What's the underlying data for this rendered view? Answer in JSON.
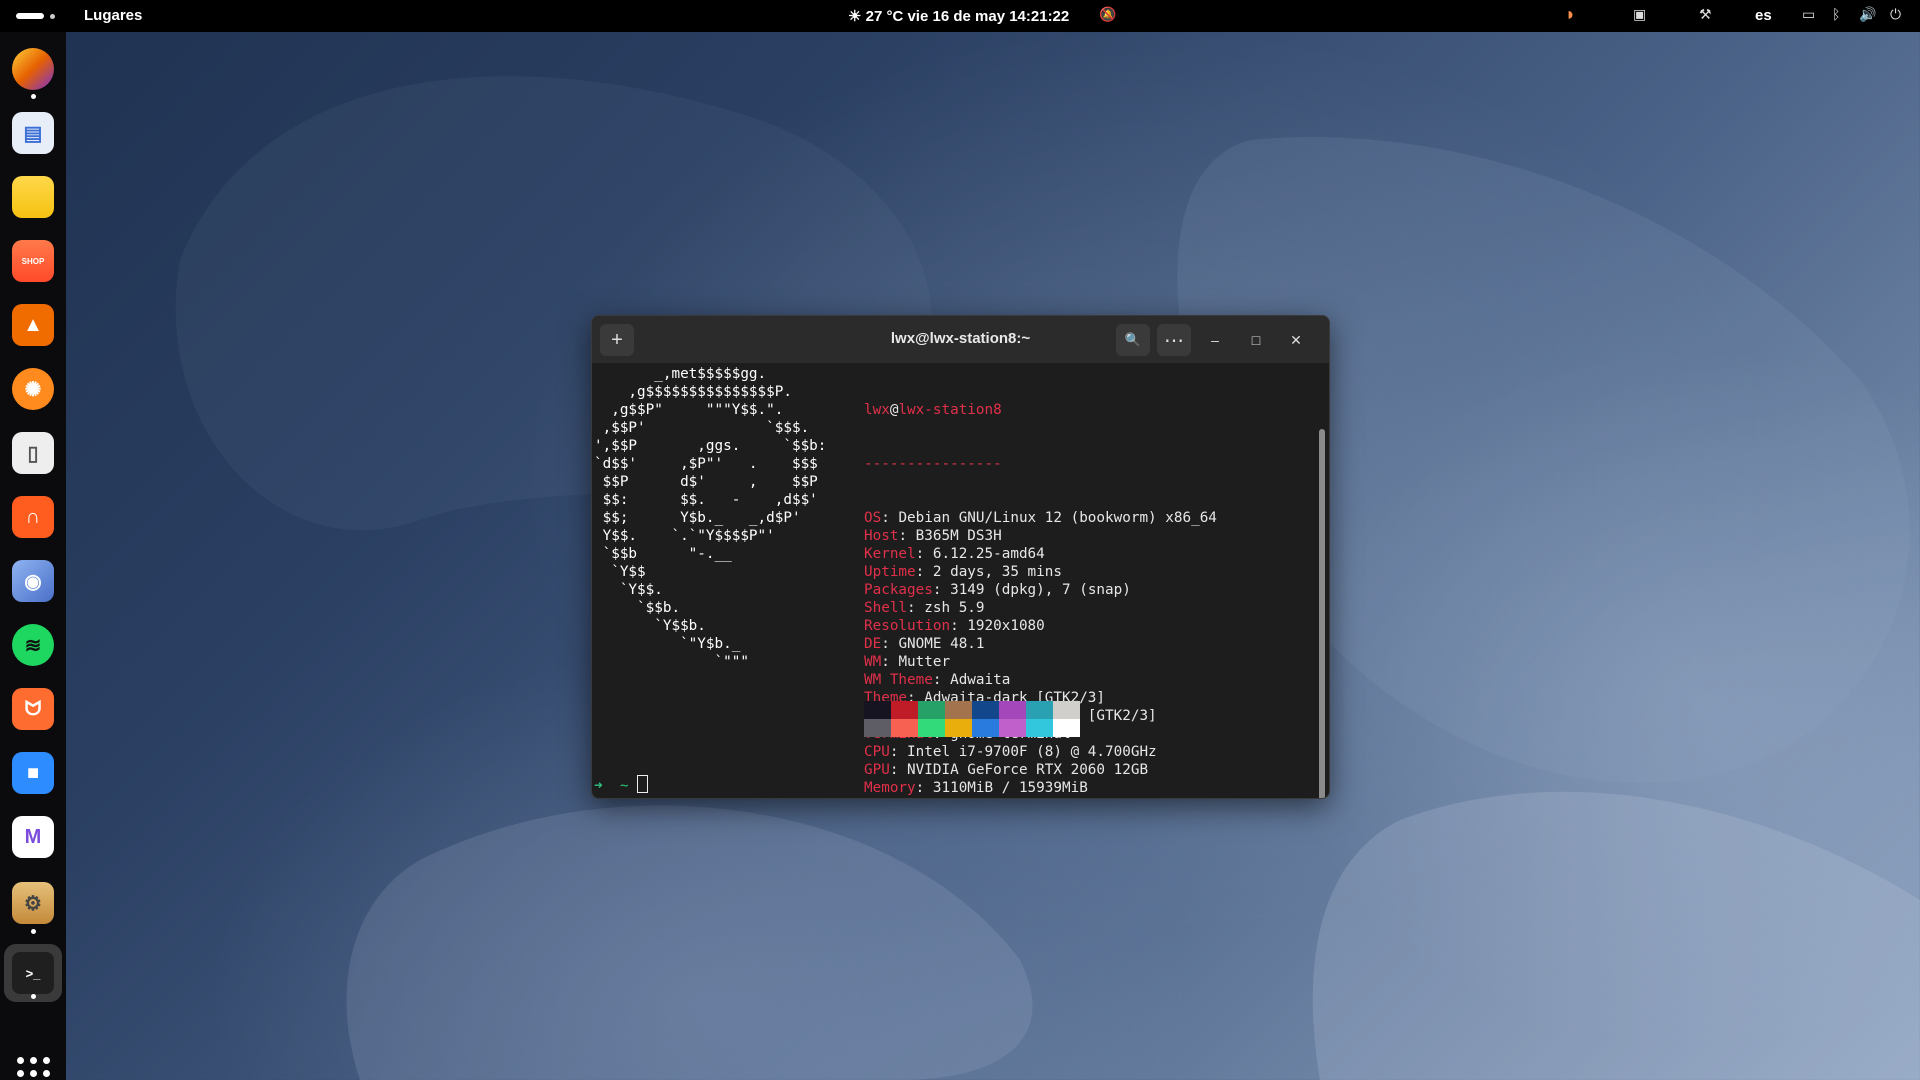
{
  "topbar": {
    "activities": "",
    "places": "Lugares",
    "clock": "☀ 27 °C  vie 16 de may  14:21:22",
    "language": "es"
  },
  "dock": {
    "apps": [
      {
        "name": "firefox",
        "color": "#e66000"
      },
      {
        "name": "text-editor",
        "color": "#3b6fd6"
      },
      {
        "name": "files",
        "color": "#f5c211"
      },
      {
        "name": "shop",
        "color": "#ff5a36"
      },
      {
        "name": "vlc",
        "color": "#f06b00"
      },
      {
        "name": "orange",
        "color": "#ff8a1e"
      },
      {
        "name": "documents",
        "color": "#e8e8e8"
      },
      {
        "name": "headphones",
        "color": "#ff5d1f"
      },
      {
        "name": "camera",
        "color": "#5a86d8"
      },
      {
        "name": "spotify",
        "color": "#1ed760"
      },
      {
        "name": "gnome-fox",
        "color": "#ff6c2f"
      },
      {
        "name": "zoom",
        "color": "#2d8cff"
      },
      {
        "name": "mail",
        "color": "#ffffff"
      },
      {
        "name": "settings",
        "color": "#d9a650"
      },
      {
        "name": "terminal",
        "color": "#2e2e2e"
      }
    ]
  },
  "terminal": {
    "title": "lwx@lwx-station8:~",
    "new_tab_label": "+",
    "search_label": "🔍",
    "menu_label": "⋯",
    "minimize_label": "–",
    "maximize_label": "□",
    "close_label": "✕",
    "logo": "       _,met$$$$$gg.\n    ,g$$$$$$$$$$$$$$$P.\n  ,g$$P\"     \"\"\"Y$$.\".\n ,$$P'              `$$$.\n',$$P       ,ggs.     `$$b:\n`d$$'     ,$P\"'   .    $$$\n $$P      d$'     ,    $$P\n $$:      $$.   -    ,d$$'\n $$;      Y$b._   _,d$P'\n Y$$.    `.`\"Y$$$$P\"'\n `$$b      \"-.__\n  `Y$$\n   `Y$$.\n     `$$b.\n       `Y$$b.\n          `\"Y$b._\n              `\"\"\"",
    "user": "lwx",
    "at": "@",
    "host": "lwx-station8",
    "rule": "----------------",
    "info": [
      {
        "label": "OS",
        "value": "Debian GNU/Linux 12 (bookworm) x86_64"
      },
      {
        "label": "Host",
        "value": "B365M DS3H"
      },
      {
        "label": "Kernel",
        "value": "6.12.25-amd64"
      },
      {
        "label": "Uptime",
        "value": "2 days, 35 mins"
      },
      {
        "label": "Packages",
        "value": "3149 (dpkg), 7 (snap)"
      },
      {
        "label": "Shell",
        "value": "zsh 5.9"
      },
      {
        "label": "Resolution",
        "value": "1920x1080"
      },
      {
        "label": "DE",
        "value": "GNOME 48.1"
      },
      {
        "label": "WM",
        "value": "Mutter"
      },
      {
        "label": "WM Theme",
        "value": "Adwaita"
      },
      {
        "label": "Theme",
        "value": "Adwaita-dark [GTK2/3]"
      },
      {
        "label": "Icons",
        "value": "Reversal-blue-dark [GTK2/3]"
      },
      {
        "label": "Terminal",
        "value": "gnome-terminal"
      },
      {
        "label": "CPU",
        "value": "Intel i7-9700F (8) @ 4.700GHz"
      },
      {
        "label": "GPU",
        "value": "NVIDIA GeForce RTX 2060 12GB"
      },
      {
        "label": "Memory",
        "value": "3110MiB / 15939MiB"
      }
    ],
    "palette_dark": [
      "#171421",
      "#c01c28",
      "#26a269",
      "#a2734c",
      "#12488b",
      "#a347ba",
      "#2aa1b3",
      "#d0cfcc"
    ],
    "palette_bright": [
      "#5e5c64",
      "#f66151",
      "#33da7a",
      "#e9ad0c",
      "#2a7bde",
      "#c061cb",
      "#33c7de",
      "#ffffff"
    ],
    "prompt": "➜  ~ "
  }
}
